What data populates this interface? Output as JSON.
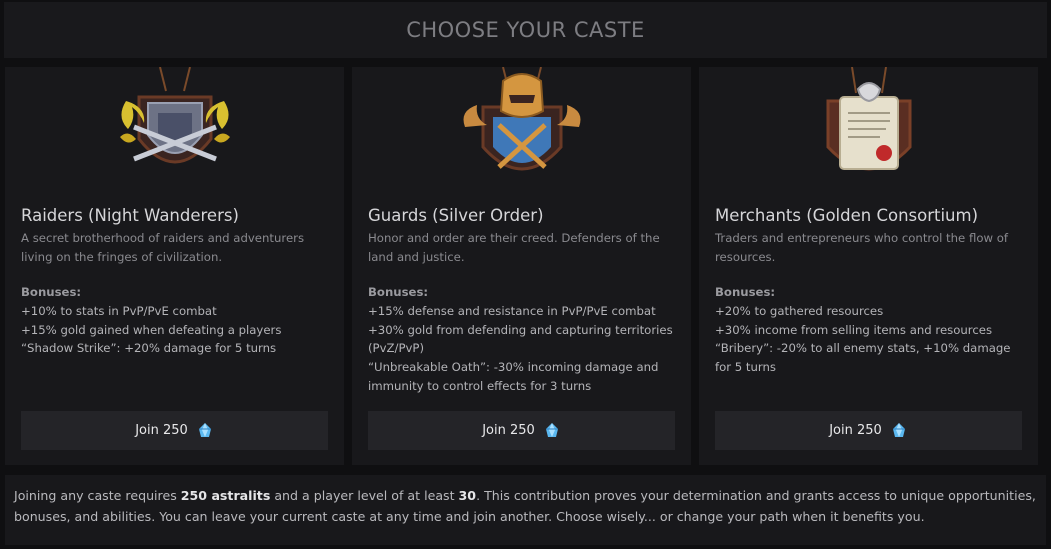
{
  "header": {
    "title": "CHOOSE YOUR CASTE"
  },
  "cards": [
    {
      "title": "Raiders (Night Wanderers)",
      "description": "A secret brotherhood of raiders and adventurers living on the fringes of civilization.",
      "bonuses_heading": "Bonuses:",
      "bonuses": [
        "+10% to stats in PvP/PvE combat",
        "+15% gold gained when defeating a players",
        "“Shadow Strike”: +20% damage for 5 turns"
      ],
      "join_label": "Join 250",
      "emblem": "raiders-dragon-shield-icon"
    },
    {
      "title": "Guards (Silver Order)",
      "description": "Honor and order are their creed. Defenders of the land and justice.",
      "bonuses_heading": "Bonuses:",
      "bonuses": [
        "+15% defense and resistance in PvP/PvE combat",
        "+30% gold from defending and capturing territories (PvZ/PvP)",
        "“Unbreakable Oath”: -30% incoming damage and immunity to control effects for 3 turns"
      ],
      "join_label": "Join 250",
      "emblem": "guards-helmet-shield-icon"
    },
    {
      "title": "Merchants (Golden Consortium)",
      "description": "Traders and entrepreneurs who control the flow of resources.",
      "bonuses_heading": "Bonuses:",
      "bonuses": [
        "+20% to gathered resources",
        "+30% income from selling items and resources",
        "“Bribery”: -20% to all enemy stats, +10% damage for 5 turns"
      ],
      "join_label": "Join 250",
      "emblem": "merchants-scroll-shield-icon"
    }
  ],
  "footer": {
    "text_1": "Joining any caste requires ",
    "bold_1": "250 astralits",
    "text_2": " and a player level of at least ",
    "bold_2": "30",
    "text_3": ". This contribution proves your determination and grants access to unique opportunities, bonuses, and abilities. You can leave your current caste at any time and join another. Choose wisely... or change your path when it benefits you."
  },
  "colors": {
    "background": "#0f0f11",
    "panel": "#18181b",
    "button": "#242428",
    "gem": "#5bb8f0"
  }
}
